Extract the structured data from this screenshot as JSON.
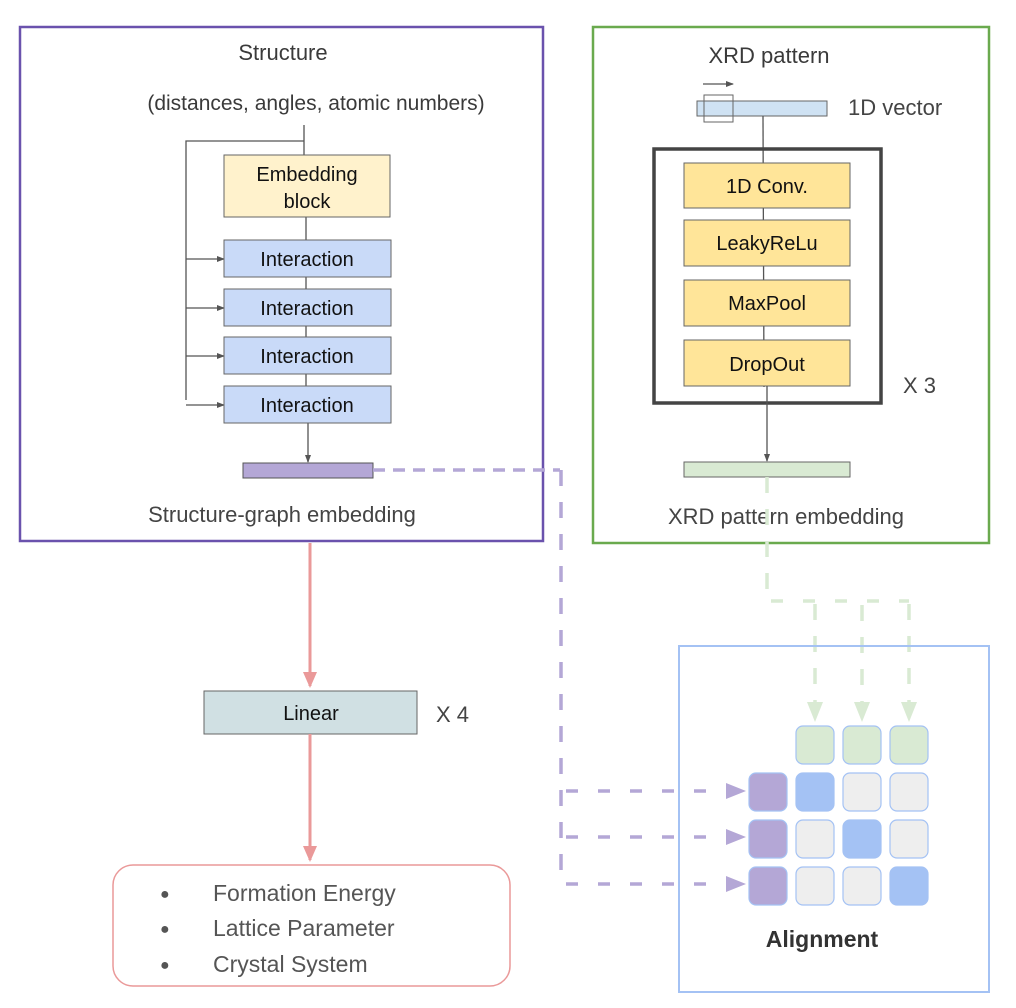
{
  "colors": {
    "structure_frame": "#6a52ad",
    "xrd_frame": "#6aaa4e",
    "alignment_frame": "#a4c2f4",
    "embedding_block": "#fff2cc",
    "interaction_block": "#c9daf8",
    "cnn_block": "#ffe599",
    "linear_block": "#d0e0e3",
    "structure_embedding": "#b4a7d6",
    "xrd_embedding": "#d9ead3",
    "xrd_vector": "#cfe2f3",
    "red_arrow": "#ea9999",
    "purple_dash": "#b4a7d6",
    "green_dash": "#d9ead3",
    "matrix_diag": "#a4c2f4",
    "matrix_off": "#eeeeee",
    "output_frame": "#ea9999"
  },
  "structure": {
    "title": "Structure",
    "inputs": "(distances, angles, atomic numbers)",
    "embedding_block": [
      "Embedding",
      "block"
    ],
    "interactions": [
      "Interaction",
      "Interaction",
      "Interaction",
      "Interaction"
    ],
    "output_label": "Structure-graph embedding"
  },
  "xrd": {
    "title": "XRD pattern",
    "vector_label": "1D vector",
    "layers": [
      "1D Conv.",
      "LeakyReLu",
      "MaxPool",
      "DropOut"
    ],
    "repeat_label": "X 3",
    "output_label": "XRD pattern embedding"
  },
  "head": {
    "linear_label": "Linear",
    "repeat_label": "X 4",
    "outputs": [
      "Formation Energy",
      "Lattice Parameter",
      "Crystal System"
    ],
    "bullet": "●"
  },
  "alignment": {
    "title": "Alignment",
    "rows": 3,
    "cols": 3,
    "matrix": [
      [
        1,
        0,
        0
      ],
      [
        0,
        1,
        0
      ],
      [
        0,
        0,
        1
      ]
    ]
  }
}
